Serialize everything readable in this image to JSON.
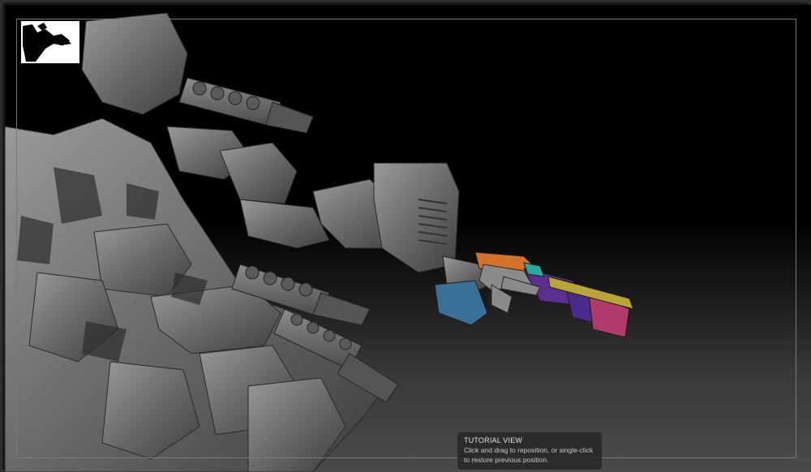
{
  "viewport": {
    "navigation_thumbnail": "model-navigator-thumbnail",
    "background_gradient": [
      "#000000",
      "#4a4a4a"
    ],
    "model_color": "#6e6e6e",
    "polygroup_colors": [
      "#3a6f98",
      "#5b2f8f",
      "#b03a6a",
      "#d4722a",
      "#2fa9a0",
      "#b9a43a"
    ]
  },
  "tooltip": {
    "title": "TUTORIAL VIEW",
    "body": "Click and drag to reposition, or single-click to restore previous position."
  }
}
